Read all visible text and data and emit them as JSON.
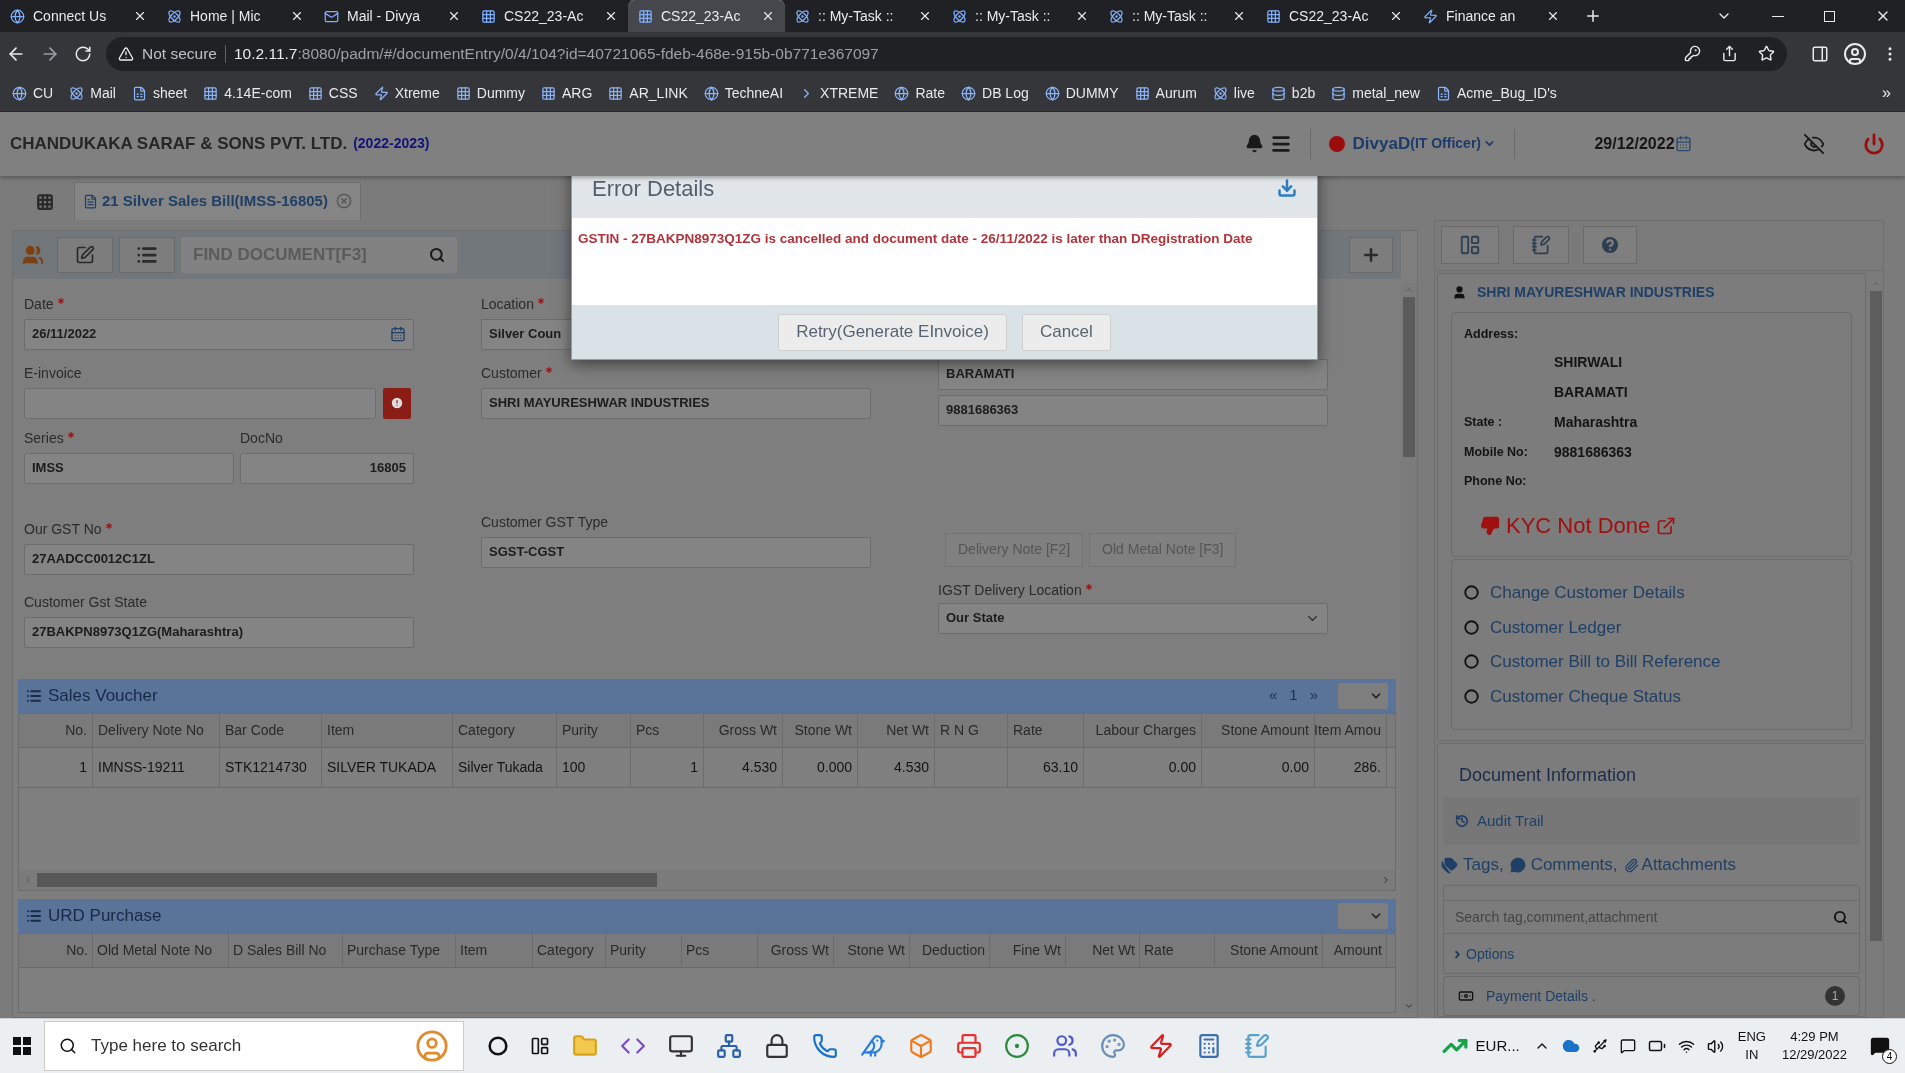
{
  "browser": {
    "tabs": [
      {
        "label": "Connect Us",
        "selected": false
      },
      {
        "label": "Home | Mic",
        "selected": false
      },
      {
        "label": "Mail - Divya",
        "selected": false
      },
      {
        "label": "CS22_23-Ac",
        "selected": false
      },
      {
        "label": "CS22_23-Ac",
        "selected": true
      },
      {
        "label": ":: My-Task ::",
        "selected": false
      },
      {
        "label": ":: My-Task ::",
        "selected": false
      },
      {
        "label": ":: My-Task ::",
        "selected": false
      },
      {
        "label": "CS22_23-Ac",
        "selected": false
      },
      {
        "label": "Finance an",
        "selected": false
      }
    ],
    "security": "Not secure",
    "url_host": "10.2.11.7",
    "url_path": ":8080/padm/#/documentEntry/0/4/104?id=40721065-fdeb-468e-915b-0b771e367097",
    "bookmarks": [
      "CU",
      "Mail",
      "sheet",
      "4.14E-com",
      "CSS",
      "Xtreme",
      "Dummy",
      "ARG",
      "AR_LINK",
      "TechneAI",
      "XTREME",
      "Rate",
      "DB Log",
      "DUMMY",
      "Aurum",
      "live",
      "b2b",
      "metal_new",
      "Acme_Bug_ID's"
    ],
    "bookmarks_more": "»"
  },
  "header": {
    "company": "CHANDUKAKA SARAF & SONS PVT. LTD.",
    "year": "(2022-2023)",
    "user": "DivyaD",
    "role": "(IT Officer)",
    "date": "29/12/2022"
  },
  "doc_tab": {
    "label": "21 Silver Sales Bill(IMSS-16805)"
  },
  "toolbar": {
    "find_placeholder": "FIND DOCUMENT[F3]"
  },
  "form": {
    "date": {
      "label": "Date",
      "required": true,
      "value": "26/11/2022"
    },
    "einvoice": {
      "label": "E-invoice"
    },
    "series": {
      "label": "Series",
      "required": true,
      "value": "IMSS"
    },
    "docno": {
      "label": "DocNo",
      "value": "16805"
    },
    "our_gst": {
      "label": "Our GST No",
      "required": true,
      "value": "27AADCC0012C1ZL"
    },
    "customer_gst_state": {
      "label": "Customer Gst State",
      "value": "27BAKPN8973Q1ZG(Maharashtra)"
    },
    "location": {
      "label": "Location",
      "required": true,
      "value": "Silver Coun"
    },
    "customer": {
      "label": "Customer",
      "required": true,
      "value": "SHRI MAYURESHWAR INDUSTRIES"
    },
    "customer_gst_type": {
      "label": "Customer GST Type",
      "value": "SGST-CGST"
    },
    "city": {
      "value": "BARAMATI"
    },
    "mobile": {
      "value": "9881686363"
    },
    "note_buttons": [
      "Delivery Note [F2]",
      "Old Metal Note [F3]"
    ],
    "igst": {
      "label": "IGST Delivery Location",
      "required": true,
      "value": "Our State"
    }
  },
  "sales_voucher": {
    "title": "Sales Voucher",
    "pager": [
      "«",
      "1",
      "»"
    ],
    "columns": [
      "No.",
      "Delivery Note No",
      "Bar Code",
      "Item",
      "Category",
      "Purity",
      "Pcs",
      "Gross Wt",
      "Stone Wt",
      "Net Wt",
      "R N G",
      "Rate",
      "Labour Charges",
      "Stone Amount",
      "Item Amou"
    ],
    "rows": [
      [
        "1",
        "IMNSS-19211",
        "STK1214730",
        "SILVER TUKADA",
        "Silver Tukada",
        "100",
        "1",
        "4.530",
        "0.000",
        "4.530",
        null,
        "63.10",
        "0.00",
        "0.00",
        "286."
      ]
    ]
  },
  "urd_purchase": {
    "title": "URD Purchase",
    "columns": [
      "No.",
      "Old Metal Note No",
      "D Sales Bill No",
      "Purchase Type",
      "Item",
      "Category",
      "Purity",
      "Pcs",
      "Gross Wt",
      "Stone Wt",
      "Deduction",
      "Fine Wt",
      "Net Wt",
      "Rate",
      "Stone Amount",
      "Amount"
    ]
  },
  "customer_panel": {
    "name": "SHRI MAYURESHWAR INDUSTRIES",
    "address_label": "Address:",
    "address_lines": [
      "SHIRWALI",
      "BARAMATI"
    ],
    "state_label": "State :",
    "state": "Maharashtra",
    "mobile_label": "Mobile No:",
    "mobile": "9881686363",
    "phone_label": "Phone No:",
    "kyc": "KYC Not Done",
    "links": [
      "Change Customer Details",
      "Customer Ledger",
      "Customer Bill to Bill Reference",
      "Customer Cheque Status"
    ]
  },
  "document_info": {
    "title": "Document Information",
    "audit_trail": "Audit Trail",
    "tags": "Tags,",
    "comments": "Comments,",
    "attachments": "Attachments",
    "search_placeholder": "Search tag,comment,attachment",
    "options": "Options",
    "payment_details": "Payment Details .",
    "payment_count": "1"
  },
  "dialog": {
    "title": "Error Details",
    "message": "GSTIN - 27BAKPN8973Q1ZG is cancelled and document date - 26/11/2022 is later than DRegistration Date",
    "buttons": [
      "Retry(Generate EInvoice)",
      "Cancel"
    ]
  },
  "taskbar": {
    "search_placeholder": "Type here to search",
    "ticker": "EUR...",
    "lang": "ENG",
    "region": "IN",
    "time": "4:29 PM",
    "date": "12/29/2022",
    "notifications": "4"
  }
}
